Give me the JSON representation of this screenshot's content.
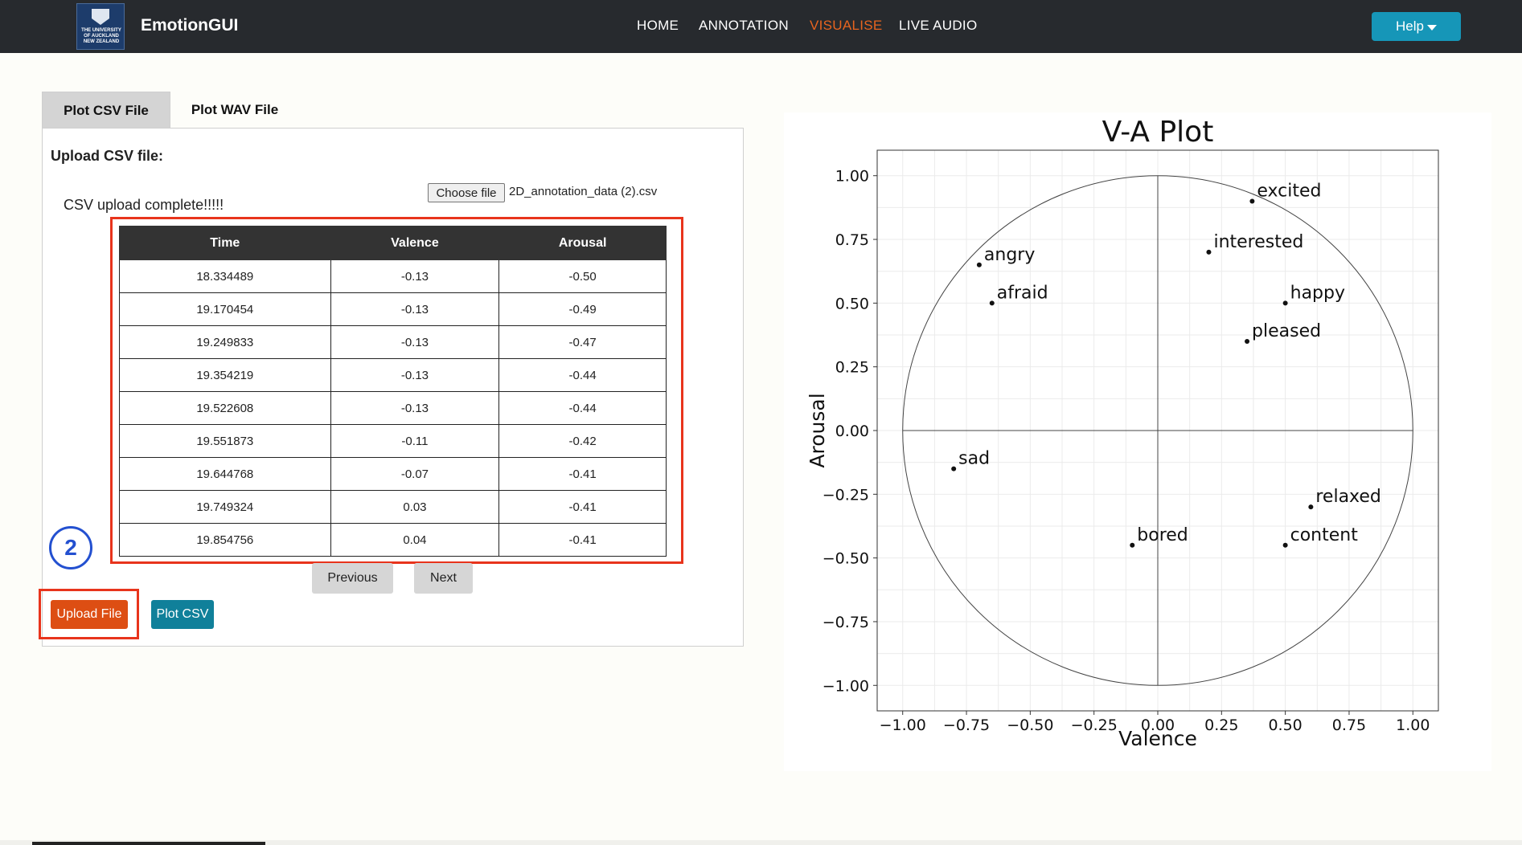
{
  "navbar": {
    "logo_text": "THE UNIVERSITY OF AUCKLAND NEW ZEALAND",
    "brand": "EmotionGUI",
    "links": [
      "HOME",
      "ANNOTATION",
      "VISUALISE",
      "LIVE AUDIO"
    ],
    "active": "VISUALISE",
    "help_label": "Help"
  },
  "tabs": [
    "Plot CSV File",
    "Plot WAV File"
  ],
  "upload": {
    "label": "Upload CSV file:",
    "choose_label": "Choose file",
    "file_name": "2D_annotation_data (2).csv",
    "status": "CSV upload complete!!!!!"
  },
  "table": {
    "headers": [
      "Time",
      "Valence",
      "Arousal"
    ],
    "rows": [
      [
        "18.334489",
        "-0.13",
        "-0.50"
      ],
      [
        "19.170454",
        "-0.13",
        "-0.49"
      ],
      [
        "19.249833",
        "-0.13",
        "-0.47"
      ],
      [
        "19.354219",
        "-0.13",
        "-0.44"
      ],
      [
        "19.522608",
        "-0.13",
        "-0.44"
      ],
      [
        "19.551873",
        "-0.11",
        "-0.42"
      ],
      [
        "19.644768",
        "-0.07",
        "-0.41"
      ],
      [
        "19.749324",
        "0.03",
        "-0.41"
      ],
      [
        "19.854756",
        "0.04",
        "-0.41"
      ]
    ]
  },
  "pager": {
    "previous": "Previous",
    "next": "Next"
  },
  "annotation_marker": "2",
  "buttons": {
    "upload": "Upload File",
    "plot": "Plot CSV"
  },
  "colors": {
    "accent": "#e7641f",
    "help": "#1696b8",
    "upload": "#dd4e13",
    "plot": "#10809a",
    "highlight": "#e8341c",
    "marker": "#2350d0"
  },
  "chart_data": {
    "type": "scatter",
    "title": "V-A Plot",
    "xlabel": "Valence",
    "ylabel": "Arousal",
    "xlim": [
      -1.1,
      1.1
    ],
    "ylim": [
      -1.1,
      1.1
    ],
    "xticks": [
      "−1.00",
      "−0.75",
      "−0.50",
      "−0.25",
      "0.00",
      "0.25",
      "0.50",
      "0.75",
      "1.00"
    ],
    "yticks": [
      "1.00",
      "0.75",
      "0.50",
      "0.25",
      "0.00",
      "−0.25",
      "−0.50",
      "−0.75",
      "−1.00"
    ],
    "tick_values": [
      -1,
      -0.75,
      -0.5,
      -0.25,
      0,
      0.25,
      0.5,
      0.75,
      1
    ],
    "grid": true,
    "unit_circle": true,
    "points": [
      {
        "label": "excited",
        "x": 0.37,
        "y": 0.9
      },
      {
        "label": "interested",
        "x": 0.2,
        "y": 0.7
      },
      {
        "label": "happy",
        "x": 0.5,
        "y": 0.5
      },
      {
        "label": "pleased",
        "x": 0.35,
        "y": 0.35
      },
      {
        "label": "angry",
        "x": -0.7,
        "y": 0.65
      },
      {
        "label": "afraid",
        "x": -0.65,
        "y": 0.5
      },
      {
        "label": "sad",
        "x": -0.8,
        "y": -0.15
      },
      {
        "label": "relaxed",
        "x": 0.6,
        "y": -0.3
      },
      {
        "label": "bored",
        "x": -0.1,
        "y": -0.45
      },
      {
        "label": "content",
        "x": 0.5,
        "y": -0.45
      }
    ]
  }
}
